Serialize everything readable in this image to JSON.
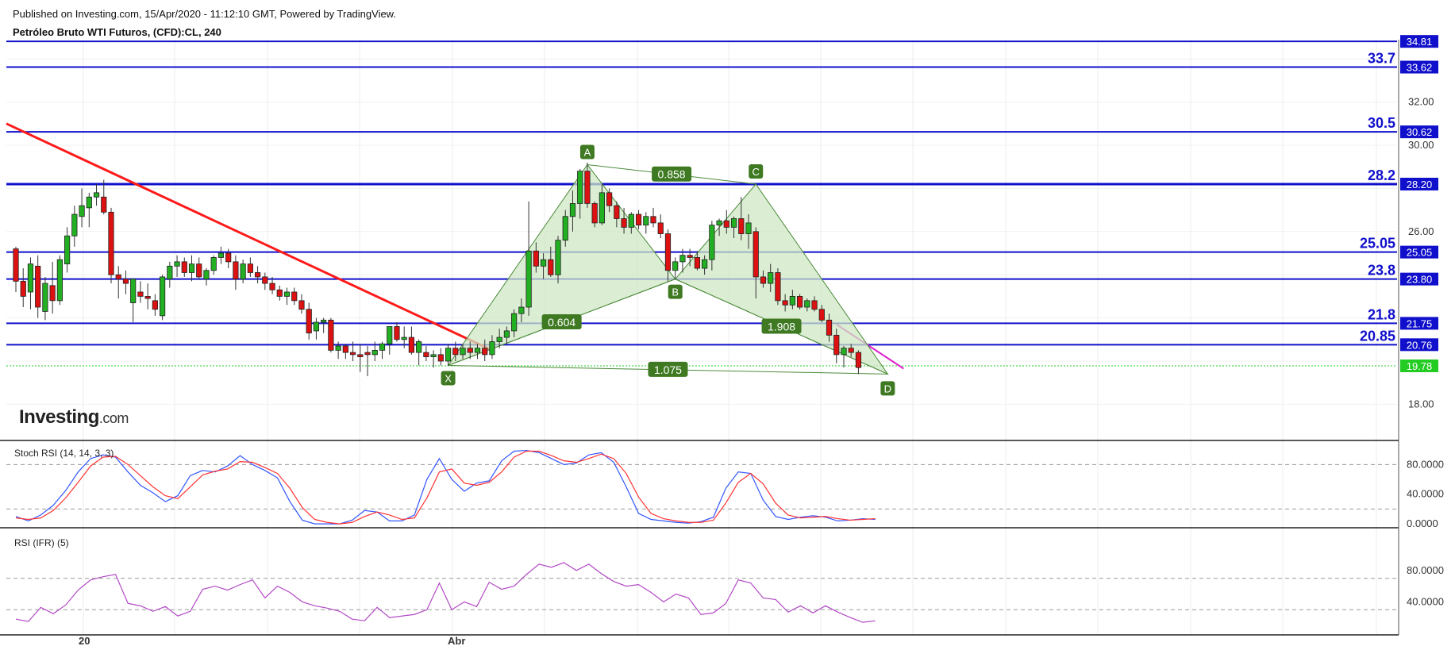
{
  "header": {
    "published": "Published on Investing.com, 15/Apr/2020 - 11:12:10 GMT, Powered by TradingView.",
    "symbol": "Petróleo Bruto WTI Futuros, (CFD):CL, 240"
  },
  "logo": {
    "main": "Investing",
    "suffix": ".com"
  },
  "colors": {
    "up": "#22b022",
    "down": "#dd1111",
    "level": "#1010cc",
    "trend": "#ff1a1a",
    "pattern_fill": "#cfe7c4",
    "pattern_stroke": "#4b8a3a",
    "label_bg": "#3f7a23",
    "stoch_k": "#3355ff",
    "stoch_d": "#ff3333",
    "rsi": "#b348c6",
    "last_price": "#22cc22"
  },
  "chart_data": [
    {
      "type": "candlestick",
      "title": "Petróleo Bruto WTI Futuros, (CFD):CL, 240",
      "ylim": [
        16.6,
        35.0
      ],
      "y_ticks": [
        "18.00",
        "26.00",
        "30.00",
        "32.00"
      ],
      "x_ticks": [
        "20",
        "Abr"
      ],
      "last_price": "19.78",
      "levels": [
        {
          "label": "",
          "axis_label": "34.81",
          "value": 34.81
        },
        {
          "label": "33.7",
          "axis_label": "33.62",
          "value": 33.62
        },
        {
          "label": "30.5",
          "axis_label": "30.62",
          "value": 30.62
        },
        {
          "label": "28.2",
          "axis_label": "28.20",
          "value": 28.2
        },
        {
          "label": "25.05",
          "axis_label": "25.05",
          "value": 25.05
        },
        {
          "label": "23.8",
          "axis_label": "23.80",
          "value": 23.8
        },
        {
          "label": "21.8",
          "axis_label": "21.75",
          "value": 21.75
        },
        {
          "label": "20.85",
          "axis_label": "20.76",
          "value": 20.76
        }
      ],
      "trendline": {
        "from": [
          0,
          31.0
        ],
        "to": [
          65,
          20.5
        ]
      },
      "short_trendline": {
        "from": [
          112,
          21.7
        ],
        "to": [
          119,
          19.65
        ]
      },
      "harmonic_pattern": {
        "points": [
          {
            "name": "X",
            "i": 59,
            "value": 19.8
          },
          {
            "name": "A",
            "i": 78,
            "value": 29.1
          },
          {
            "name": "B",
            "i": 90,
            "value": 23.8
          },
          {
            "name": "C",
            "i": 101,
            "value": 28.2
          },
          {
            "name": "D",
            "i": 119,
            "value": 19.4
          }
        ],
        "ratios": [
          "0.604",
          "0.858",
          "1.908",
          "1.075"
        ]
      },
      "candles": [
        [
          25.2,
          25.3,
          23.2,
          23.7
        ],
        [
          23.7,
          24.3,
          22.5,
          23.0
        ],
        [
          23.2,
          24.8,
          22.4,
          24.5
        ],
        [
          24.4,
          24.9,
          22.0,
          22.5
        ],
        [
          22.3,
          23.9,
          21.9,
          23.6
        ],
        [
          23.5,
          24.6,
          22.2,
          22.8
        ],
        [
          22.8,
          24.9,
          22.6,
          24.7
        ],
        [
          24.5,
          26.2,
          24.1,
          25.8
        ],
        [
          25.8,
          27.2,
          25.3,
          26.8
        ],
        [
          26.7,
          28.0,
          26.2,
          27.2
        ],
        [
          27.1,
          27.8,
          26.2,
          27.6
        ],
        [
          27.6,
          28.2,
          27.2,
          27.8
        ],
        [
          27.6,
          28.4,
          26.8,
          26.9
        ],
        [
          26.9,
          27.1,
          23.6,
          24.0
        ],
        [
          24.0,
          24.4,
          22.9,
          23.8
        ],
        [
          23.8,
          24.2,
          23.1,
          23.6
        ],
        [
          22.7,
          23.7,
          21.8,
          23.8
        ],
        [
          23.2,
          23.7,
          22.7,
          23.0
        ],
        [
          23.0,
          23.6,
          22.4,
          22.9
        ],
        [
          22.8,
          23.1,
          22.1,
          22.4
        ],
        [
          22.1,
          24.0,
          21.9,
          23.9
        ],
        [
          23.8,
          24.6,
          23.4,
          24.4
        ],
        [
          24.4,
          24.9,
          23.9,
          24.6
        ],
        [
          24.6,
          24.8,
          23.9,
          24.1
        ],
        [
          24.1,
          24.9,
          23.7,
          24.5
        ],
        [
          24.5,
          24.8,
          23.8,
          23.9
        ],
        [
          23.8,
          24.3,
          23.5,
          24.2
        ],
        [
          24.2,
          24.9,
          24.0,
          24.8
        ],
        [
          24.8,
          25.3,
          24.5,
          25.0
        ],
        [
          25.0,
          25.2,
          24.3,
          24.6
        ],
        [
          24.6,
          24.9,
          23.3,
          23.8
        ],
        [
          23.8,
          24.7,
          23.6,
          24.5
        ],
        [
          24.5,
          24.8,
          23.9,
          24.1
        ],
        [
          24.1,
          24.4,
          23.6,
          23.9
        ],
        [
          23.9,
          24.1,
          23.3,
          23.6
        ],
        [
          23.6,
          23.9,
          23.1,
          23.3
        ],
        [
          23.3,
          23.5,
          22.8,
          23.0
        ],
        [
          23.0,
          23.4,
          22.6,
          23.2
        ],
        [
          23.2,
          23.4,
          22.6,
          22.8
        ],
        [
          22.8,
          23.1,
          22.2,
          22.4
        ],
        [
          22.4,
          22.7,
          21.0,
          21.3
        ],
        [
          21.4,
          22.0,
          21.0,
          21.8
        ],
        [
          21.8,
          22.0,
          21.3,
          21.9
        ],
        [
          21.9,
          22.0,
          20.4,
          20.5
        ],
        [
          20.5,
          20.9,
          20.1,
          20.7
        ],
        [
          20.7,
          20.8,
          20.1,
          20.4
        ],
        [
          20.4,
          20.9,
          20.0,
          20.3
        ],
        [
          20.3,
          20.8,
          19.5,
          20.2
        ],
        [
          20.4,
          20.7,
          19.3,
          20.3
        ],
        [
          20.3,
          20.9,
          20.0,
          20.5
        ],
        [
          20.5,
          20.9,
          20.1,
          20.8
        ],
        [
          20.8,
          21.4,
          20.3,
          21.6
        ],
        [
          21.6,
          21.8,
          20.9,
          21.0
        ],
        [
          21.0,
          21.6,
          20.6,
          21.1
        ],
        [
          21.1,
          21.6,
          20.3,
          20.4
        ],
        [
          20.4,
          21.0,
          19.8,
          20.9
        ],
        [
          20.4,
          20.7,
          20.0,
          20.2
        ],
        [
          20.2,
          20.5,
          19.7,
          20.3
        ],
        [
          20.3,
          20.6,
          19.8,
          20.0
        ],
        [
          20.0,
          20.8,
          19.8,
          20.6
        ],
        [
          20.6,
          20.9,
          20.0,
          20.3
        ],
        [
          20.3,
          20.8,
          20.1,
          20.6
        ],
        [
          20.6,
          20.9,
          20.1,
          20.4
        ],
        [
          20.4,
          20.8,
          20.1,
          20.6
        ],
        [
          20.6,
          21.0,
          20.0,
          20.3
        ],
        [
          20.3,
          21.2,
          20.1,
          20.9
        ],
        [
          20.9,
          21.5,
          20.6,
          21.1
        ],
        [
          21.1,
          21.6,
          20.8,
          21.4
        ],
        [
          21.4,
          22.4,
          21.1,
          22.2
        ],
        [
          22.2,
          22.9,
          21.8,
          22.5
        ],
        [
          22.5,
          27.4,
          22.1,
          25.1
        ],
        [
          25.1,
          25.5,
          24.1,
          24.4
        ],
        [
          24.4,
          25.0,
          23.8,
          24.7
        ],
        [
          24.7,
          25.3,
          23.9,
          24.0
        ],
        [
          24.0,
          25.8,
          23.6,
          25.6
        ],
        [
          25.6,
          27.0,
          25.3,
          26.7
        ],
        [
          26.7,
          27.9,
          26.0,
          27.3
        ],
        [
          27.3,
          28.9,
          26.6,
          28.8
        ],
        [
          28.8,
          29.2,
          27.1,
          27.3
        ],
        [
          27.3,
          27.4,
          26.2,
          26.4
        ],
        [
          26.4,
          28.2,
          26.3,
          27.8
        ],
        [
          27.8,
          28.0,
          26.9,
          27.2
        ],
        [
          27.2,
          27.4,
          26.2,
          26.6
        ],
        [
          26.6,
          27.1,
          25.9,
          26.2
        ],
        [
          26.2,
          26.9,
          25.9,
          26.8
        ],
        [
          26.8,
          27.0,
          26.1,
          26.3
        ],
        [
          26.3,
          26.9,
          25.9,
          26.7
        ],
        [
          26.7,
          27.1,
          26.2,
          26.4
        ],
        [
          26.4,
          26.8,
          25.7,
          25.9
        ],
        [
          25.9,
          26.1,
          23.7,
          24.2
        ],
        [
          24.2,
          24.8,
          23.8,
          24.6
        ],
        [
          24.6,
          25.2,
          24.1,
          24.9
        ],
        [
          24.9,
          25.2,
          24.4,
          24.8
        ],
        [
          24.8,
          25.1,
          24.2,
          24.3
        ],
        [
          24.3,
          24.9,
          24.0,
          24.7
        ],
        [
          24.7,
          26.5,
          24.2,
          26.3
        ],
        [
          26.3,
          26.6,
          25.8,
          26.5
        ],
        [
          26.5,
          27.0,
          25.9,
          26.2
        ],
        [
          26.2,
          26.7,
          25.7,
          26.6
        ],
        [
          26.6,
          27.6,
          25.6,
          25.9
        ],
        [
          25.9,
          26.8,
          25.2,
          26.4
        ],
        [
          26.0,
          26.2,
          22.9,
          23.9
        ],
        [
          23.9,
          24.2,
          23.4,
          23.6
        ],
        [
          23.6,
          24.5,
          23.2,
          24.1
        ],
        [
          24.1,
          24.3,
          22.6,
          22.8
        ],
        [
          22.8,
          23.1,
          22.3,
          22.6
        ],
        [
          22.6,
          23.3,
          22.4,
          23.0
        ],
        [
          23.0,
          23.1,
          22.4,
          22.5
        ],
        [
          22.5,
          22.9,
          22.3,
          22.8
        ],
        [
          22.8,
          23.0,
          22.3,
          22.4
        ],
        [
          22.4,
          22.6,
          21.8,
          21.9
        ],
        [
          21.9,
          22.2,
          20.9,
          21.2
        ],
        [
          21.2,
          21.5,
          19.9,
          20.3
        ],
        [
          20.3,
          20.7,
          19.7,
          20.6
        ],
        [
          20.6,
          20.8,
          20.2,
          20.4
        ],
        [
          20.4,
          20.5,
          19.4,
          19.7
        ]
      ]
    },
    {
      "type": "line",
      "title": "Stoch RSI (14, 14, 3, 3)",
      "ylim": [
        -10,
        100
      ],
      "y_ticks": [
        "80.0000",
        "40.0000",
        "0.0000"
      ],
      "series": [
        {
          "name": "",
          "values": [
            10,
            4,
            12,
            25,
            45,
            70,
            88,
            93,
            90,
            70,
            52,
            42,
            30,
            38,
            65,
            72,
            70,
            78,
            92,
            80,
            72,
            62,
            30,
            5,
            0,
            0,
            0,
            5,
            18,
            16,
            4,
            4,
            12,
            60,
            88,
            60,
            44,
            55,
            58,
            85,
            98,
            99,
            96,
            88,
            80,
            82,
            93,
            96,
            83,
            50,
            14,
            6,
            4,
            2,
            1,
            3,
            9,
            48,
            70,
            68,
            32,
            10,
            6,
            9,
            11,
            9,
            4,
            5,
            7,
            6
          ]
        },
        {
          "name": "",
          "values": [
            8,
            6,
            8,
            18,
            35,
            56,
            78,
            90,
            91,
            80,
            65,
            50,
            38,
            34,
            50,
            66,
            71,
            74,
            84,
            83,
            76,
            68,
            48,
            22,
            6,
            2,
            0,
            2,
            10,
            16,
            12,
            6,
            8,
            35,
            70,
            74,
            55,
            52,
            56,
            70,
            90,
            98,
            98,
            92,
            85,
            83,
            88,
            94,
            88,
            68,
            36,
            14,
            7,
            4,
            2,
            2,
            5,
            28,
            56,
            68,
            54,
            28,
            12,
            8,
            9,
            10,
            7,
            5,
            6,
            7
          ]
        }
      ]
    },
    {
      "type": "line",
      "title": "RSI (IFR) (5)",
      "ylim": [
        5,
        100
      ],
      "y_ticks": [
        "80.0000",
        "40.0000"
      ],
      "series": [
        {
          "name": "",
          "values": [
            18,
            15,
            33,
            25,
            36,
            55,
            68,
            72,
            75,
            38,
            35,
            28,
            34,
            22,
            28,
            56,
            60,
            55,
            62,
            68,
            45,
            60,
            52,
            40,
            35,
            32,
            28,
            18,
            16,
            33,
            20,
            22,
            24,
            30,
            64,
            30,
            40,
            34,
            65,
            56,
            60,
            75,
            88,
            84,
            90,
            80,
            88,
            76,
            66,
            60,
            62,
            52,
            40,
            50,
            45,
            24,
            26,
            38,
            68,
            64,
            45,
            43,
            27,
            35,
            26,
            35,
            27,
            20,
            14,
            16
          ]
        }
      ]
    }
  ]
}
